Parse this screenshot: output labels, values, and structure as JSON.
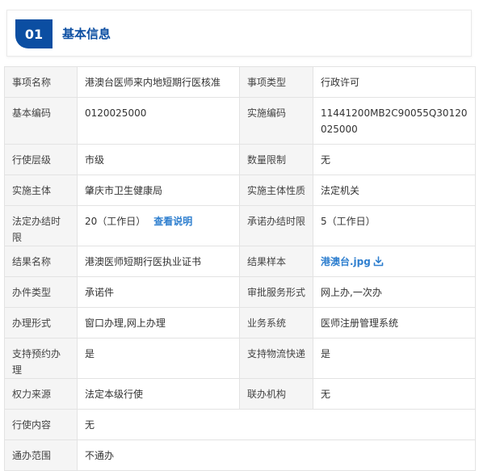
{
  "header": {
    "badge": "01",
    "title": "基本信息"
  },
  "rows": [
    {
      "l1": "事项名称",
      "v1": "港澳台医师来内地短期行医核准",
      "l2": "事项类型",
      "v2": "行政许可"
    },
    {
      "l1": "基本编码",
      "v1": "0120025000",
      "l2": "实施编码",
      "v2": "11441200MB2C90055Q30120025000"
    },
    {
      "l1": "行使层级",
      "v1": "市级",
      "l2": "数量限制",
      "v2": "无"
    },
    {
      "l1": "实施主体",
      "v1": "肇庆市卫生健康局",
      "l2": "实施主体性质",
      "v2": "法定机关"
    },
    {
      "l1": "法定办结时限",
      "v1": "20（工作日）",
      "v1_link": "查看说明",
      "l2": "承诺办结时限",
      "v2": "5（工作日）"
    },
    {
      "l1": "结果名称",
      "v1": "港澳医师短期行医执业证书",
      "l2": "结果样本",
      "v2": "港澳台.jpg",
      "v2_icon": "download-icon"
    },
    {
      "l1": "办件类型",
      "v1": "承诺件",
      "l2": "审批服务形式",
      "v2": "网上办,一次办"
    },
    {
      "l1": "办理形式",
      "v1": "窗口办理,网上办理",
      "l2": "业务系统",
      "v2": "医师注册管理系统"
    },
    {
      "l1": "支持预约办理",
      "v1": "是",
      "l2": "支持物流快递",
      "v2": "是"
    },
    {
      "l1": "权力来源",
      "v1": "法定本级行使",
      "l2": "联办机构",
      "v2": "无"
    }
  ],
  "full_rows": [
    {
      "l": "行使内容",
      "v": "无"
    },
    {
      "l": "通办范围",
      "v": "不通办"
    }
  ],
  "colors": {
    "accent": "#0b4ea2",
    "link": "#2f7fcf",
    "label_bg": "#f5f5f5",
    "border": "#e3e3e3"
  }
}
